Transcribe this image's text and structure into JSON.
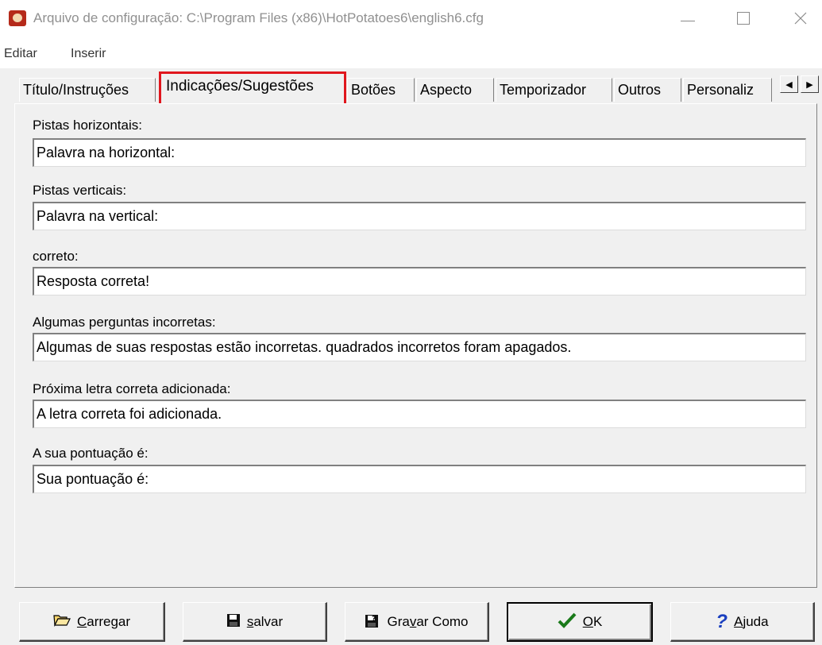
{
  "window": {
    "title": "Arquivo de configuração: C:\\Program Files (x86)\\HotPotatoes6\\english6.cfg",
    "icon": "hot-potatoes-app-icon"
  },
  "menu": {
    "items": [
      {
        "label": "Editar"
      },
      {
        "label": "Inserir"
      }
    ]
  },
  "tabs": [
    {
      "label": "Título/Instruções",
      "active": false
    },
    {
      "label": "Indicações/Sugestões",
      "active": true
    },
    {
      "label": "Botões",
      "active": false
    },
    {
      "label": "Aspecto",
      "active": false
    },
    {
      "label": "Temporizador",
      "active": false
    },
    {
      "label": "Outros",
      "active": false
    },
    {
      "label": "Personaliz",
      "active": false
    }
  ],
  "fields": [
    {
      "label": "Pistas horizontais:",
      "value": "Palavra na horizontal:"
    },
    {
      "label": "Pistas verticais:",
      "value": "Palavra na vertical:"
    },
    {
      "label": "correto:",
      "value": "Resposta correta!"
    },
    {
      "label": "Algumas perguntas incorretas:",
      "value": "Algumas de suas respostas estão incorretas. quadrados incorretos foram apagados."
    },
    {
      "label": "Próxima letra correta adicionada:",
      "value": "A letra correta foi adicionada."
    },
    {
      "label": "A sua pontuação é:",
      "value": "Sua pontuação é:"
    }
  ],
  "buttons": {
    "carregar": {
      "pre": "",
      "ul": "C",
      "post": "arregar",
      "icon": "folder-open-icon"
    },
    "salvar": {
      "pre": "",
      "ul": "s",
      "post": "alvar",
      "icon": "floppy-disk-icon"
    },
    "gravar_como": {
      "pre": "Gra",
      "ul": "v",
      "post": "ar Como",
      "icon": "save-as-icon"
    },
    "ok": {
      "pre": "",
      "ul": "O",
      "post": "K",
      "icon": "checkmark-icon"
    },
    "ajuda": {
      "pre": "",
      "ul": "A",
      "post": "juda",
      "icon": "help-question-icon"
    }
  },
  "colors": {
    "highlight": "#e0161d",
    "ok_check": "#1a7a1a",
    "help_icon": "#1a3fbf"
  }
}
